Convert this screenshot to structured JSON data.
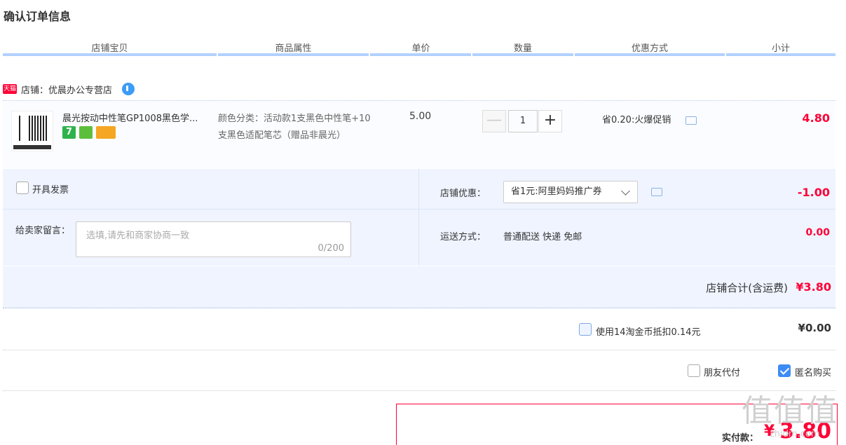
{
  "page": {
    "title": "确认订单信息"
  },
  "header": {
    "columns": [
      "店铺宝贝",
      "商品属性",
      "单价",
      "数量",
      "优惠方式",
      "小计"
    ]
  },
  "shop": {
    "badge": "天猫",
    "name": "店铺：优晨办公专营店"
  },
  "item": {
    "title": "晨光按动中性笔GP1008黑色学...",
    "attributes": "颜色分类：活动款1支黑色中性笔+10支黑色适配笔芯（赠品非晨光）",
    "unit_price": "5.00",
    "quantity": "1",
    "promotion": "省0.20:火爆促销",
    "subtotal": "4.80",
    "minus_symbol": "—",
    "plus_symbol": "+",
    "badge_seven": "7",
    "colors": {
      "accent_red": "#ff0036",
      "accent_blue": "#3d8cf5",
      "header_bar": "#b2d1ff"
    }
  },
  "options": {
    "invoice_label": "开具发票",
    "message_label": "给卖家留言：",
    "message_placeholder": "选填,请先和商家协商一致",
    "message_count": "0/200",
    "shop_discount_label": "店铺优惠：",
    "shop_discount_value": "省1元:阿里妈妈推广券",
    "shop_discount_amount": "-1.00",
    "shipping_label": "运送方式：",
    "shipping_value": "普通配送 快递 免邮",
    "shipping_amount": "0.00"
  },
  "totals": {
    "shop_total_label": "店铺合计(含运费)",
    "shop_total_value": "¥3.80",
    "coins_label": "使用14淘金币抵扣0.14元",
    "coins_value": "¥0.00",
    "friend_pay_label": "朋友代付",
    "anonymous_label": "匿名购买",
    "actual_pay_label": "实付款：",
    "actual_pay_currency": "¥",
    "actual_pay_value": "3.80"
  },
  "watermark": {
    "text": "值值值",
    "site": "zhidm.com"
  }
}
